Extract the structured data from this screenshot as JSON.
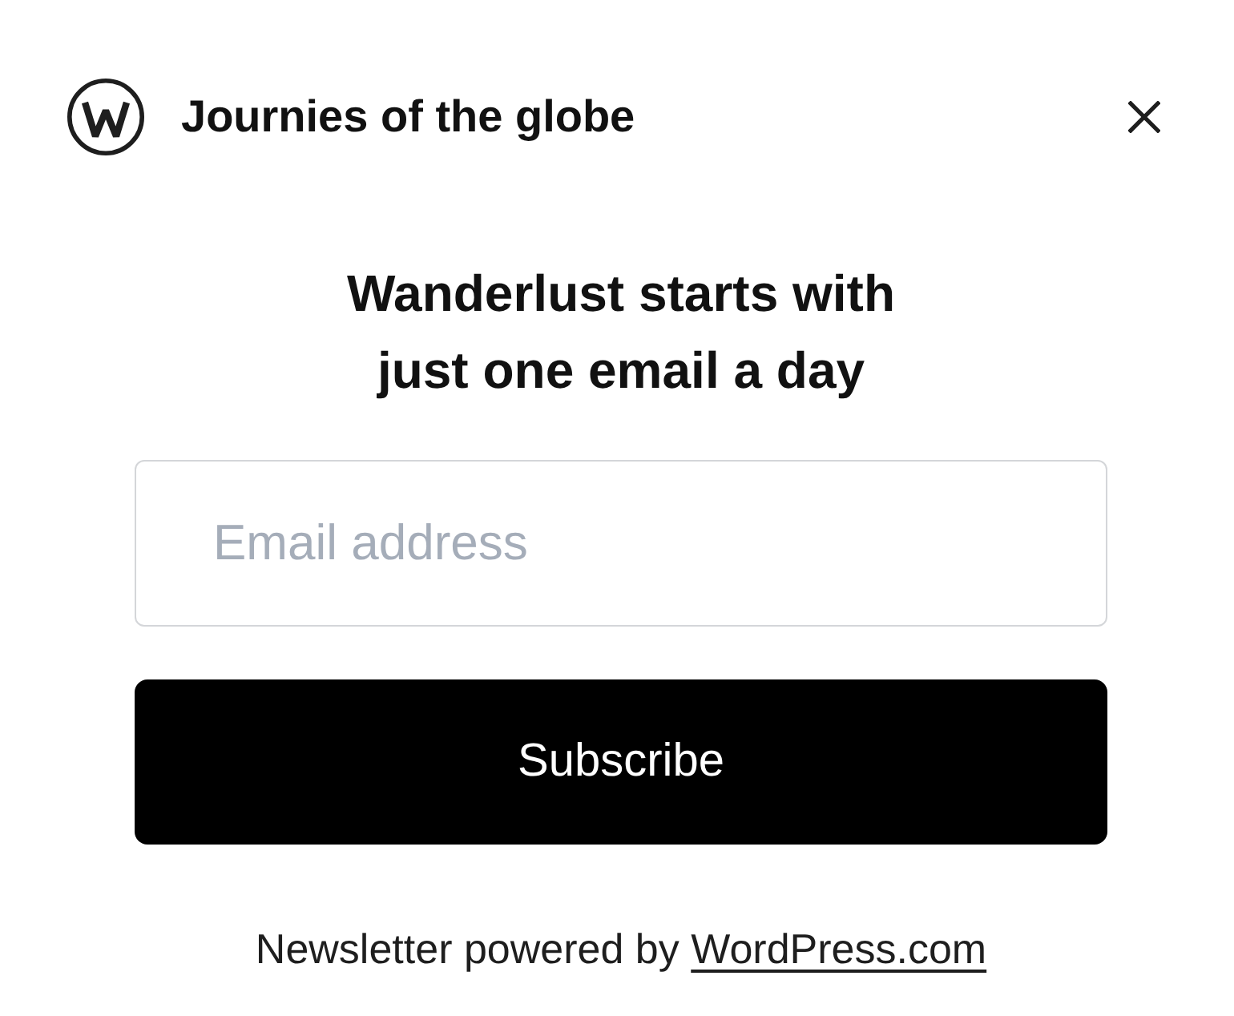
{
  "header": {
    "site_title": "Journies of the globe"
  },
  "heading": "Wanderlust starts with just one email a day",
  "email_field": {
    "placeholder": "Email address"
  },
  "subscribe_button": {
    "label": "Subscribe"
  },
  "footer": {
    "text": "Newsletter powered by",
    "link": "WordPress.com"
  }
}
